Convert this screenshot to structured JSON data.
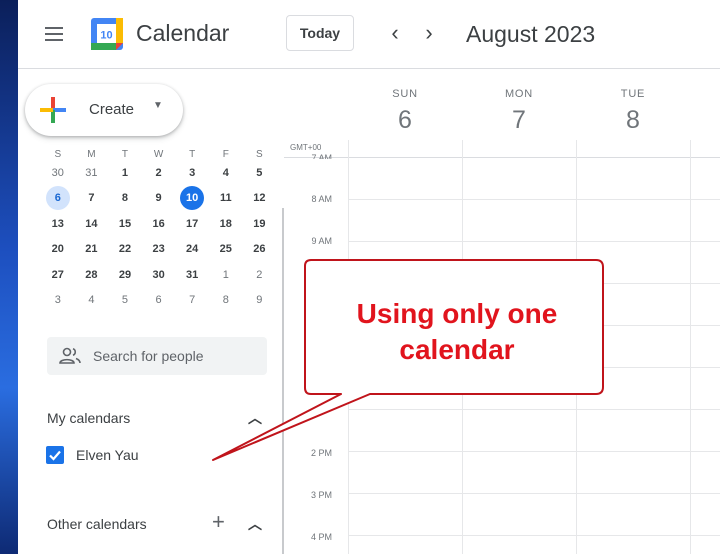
{
  "header": {
    "logo_day": "10",
    "app_title": "Calendar",
    "today_label": "Today",
    "prev_glyph": "‹",
    "next_glyph": "›",
    "period": "August 2023"
  },
  "sidebar": {
    "create_label": "Create",
    "mini_calendar": {
      "weekday_headers": [
        "S",
        "M",
        "T",
        "W",
        "T",
        "F",
        "S"
      ],
      "weeks": [
        [
          "30",
          "31",
          "1",
          "2",
          "3",
          "4",
          "5"
        ],
        [
          "6",
          "7",
          "8",
          "9",
          "10",
          "11",
          "12"
        ],
        [
          "13",
          "14",
          "15",
          "16",
          "17",
          "18",
          "19"
        ],
        [
          "20",
          "21",
          "22",
          "23",
          "24",
          "25",
          "26"
        ],
        [
          "27",
          "28",
          "29",
          "30",
          "31",
          "1",
          "2"
        ],
        [
          "3",
          "4",
          "5",
          "6",
          "7",
          "8",
          "9"
        ]
      ],
      "selected_day": "6",
      "today_day": "10"
    },
    "search_placeholder": "Search for people",
    "my_calendars_title": "My calendars",
    "my_calendar_name": "Elven Yau",
    "other_calendars_title": "Other calendars"
  },
  "grid": {
    "timezone": "GMT+00",
    "days": [
      {
        "name": "SUN",
        "number": "6"
      },
      {
        "name": "MON",
        "number": "7"
      },
      {
        "name": "TUE",
        "number": "8"
      }
    ],
    "times": [
      "7 AM",
      "8 AM",
      "9 AM",
      "2 PM",
      "3 PM",
      "4 PM"
    ]
  },
  "annotation": {
    "line1": "Using only one",
    "line2": "calendar"
  },
  "colors": {
    "accent": "#1a73e8",
    "callout_text": "#e1141d",
    "callout_border": "#c0141b"
  }
}
